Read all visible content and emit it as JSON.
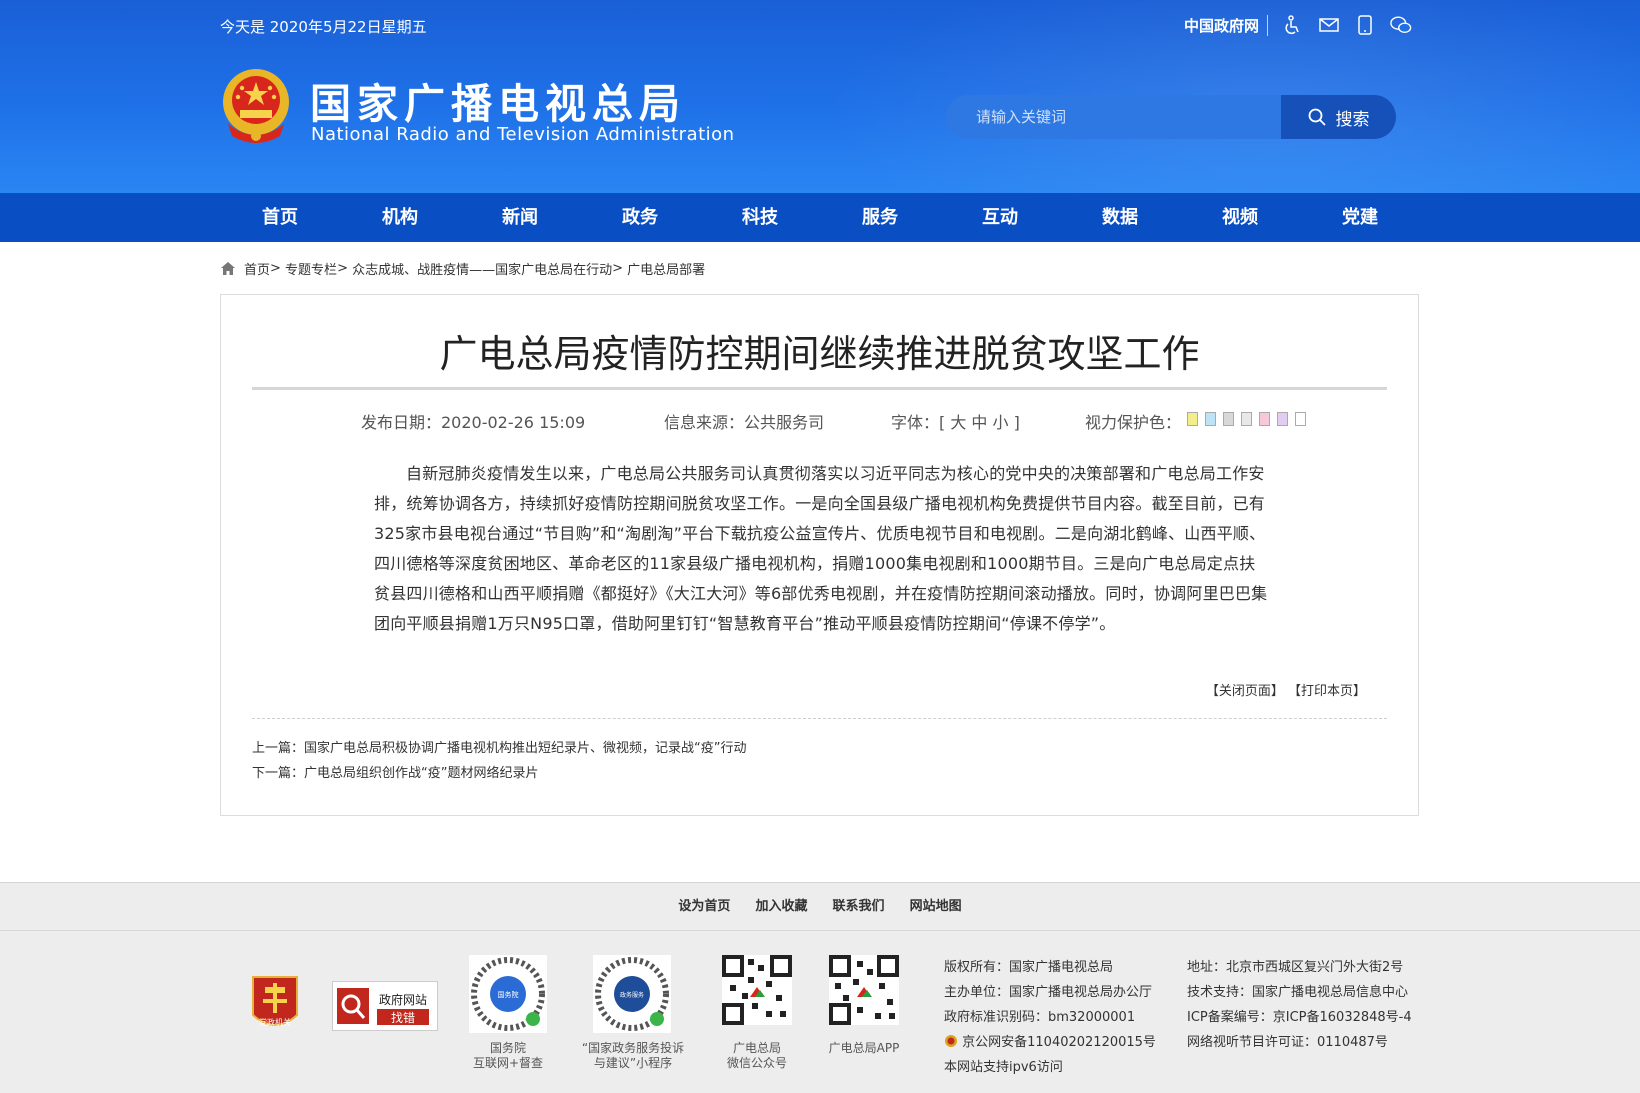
{
  "header": {
    "date": "今天是 2020年5月22日星期五",
    "gov_link": "中国政府网",
    "title_cn": "国家广播电视总局",
    "title_en": "National Radio and Television Administration",
    "search_placeholder": "请输入关键词",
    "search_button": "搜索",
    "top_icons": [
      "accessibility-icon",
      "mail-icon",
      "mobile-icon",
      "wechat-icon"
    ]
  },
  "nav": [
    "首页",
    "机构",
    "新闻",
    "政务",
    "科技",
    "服务",
    "互动",
    "数据",
    "视频",
    "党建"
  ],
  "breadcrumb": [
    "首页",
    "专题专栏",
    "众志成城、战胜疫情——国家广电总局在行动",
    "广电总局部署"
  ],
  "article": {
    "title": "广电总局疫情防控期间继续推进脱贫攻坚工作",
    "date": "发布日期：2020-02-26 15:09",
    "source": "信息来源：公共服务司",
    "font_size": "字体：[ 大 中 小 ]",
    "eye_care": "视力保护色：",
    "eye_colors": [
      "#f3ee8a",
      "#bde3f6",
      "#d8d8d8",
      "#e8e8e8",
      "#f7c9d8",
      "#e1cdf2",
      "#ffffff"
    ],
    "body": "自新冠肺炎疫情发生以来，广电总局公共服务司认真贯彻落实以习近平同志为核心的党中央的决策部署和广电总局工作安排，统筹协调各方，持续抓好疫情防控期间脱贫攻坚工作。一是向全国县级广播电视机构免费提供节目内容。截至目前，已有325家市县电视台通过“节目购”和“淘剧淘”平台下载抗疫公益宣传片、优质电视节目和电视剧。二是向湖北鹤峰、山西平顺、四川德格等深度贫困地区、革命老区的11家县级广播电视机构，捐赠1000集电视剧和1000期节目。三是向广电总局定点扶贫县四川德格和山西平顺捐赠《都挺好》《大江大河》等6部优秀电视剧，并在疫情防控期间滚动播放。同时，协调阿里巴巴集团向平顺县捐赠1万只N95口罩，借助阿里钉钉“智慧教育平台”推动平顺县疫情防控期间“停课不停学”。",
    "close_page": "【关闭页面】",
    "print_page": "【打印本页】",
    "prev": "上一篇：国家广电总局积极协调广播电视机构推出短纪录片、微视频，记录战“疫”行动",
    "next": "下一篇：广电总局组织创作战“疫”题材网络纪录片"
  },
  "footer": {
    "links": [
      "设为首页",
      "加入收藏",
      "联系我们",
      "网站地图"
    ],
    "party_badge": "党政机关",
    "gov_badge_top": "政府网站",
    "gov_badge_bottom": "找错",
    "qr": [
      {
        "inner": "国务院",
        "caption1": "国务院",
        "caption2": "互联网+督查"
      },
      {
        "inner": "政务服务",
        "caption1": "“国家政务服务投诉",
        "caption2": "与建议”小程序"
      },
      {
        "inner": "",
        "caption1": "广电总局",
        "caption2": "微信公众号"
      },
      {
        "inner": "",
        "caption1": "广电总局APP",
        "caption2": ""
      }
    ],
    "info_left": [
      "版权所有：国家广播电视总局",
      "主办单位：国家广播电视总局办公厅",
      "政府标准识别码：bm32000001",
      "京公网安备11040202120015号",
      "本网站支持ipv6访问"
    ],
    "info_right": [
      "地址：北京市西城区复兴门外大街2号",
      "技术支持：国家广播电视总局信息中心",
      "ICP备案编号：京ICP备16032848号-4",
      "网络视听节目许可证：0110487号"
    ]
  }
}
